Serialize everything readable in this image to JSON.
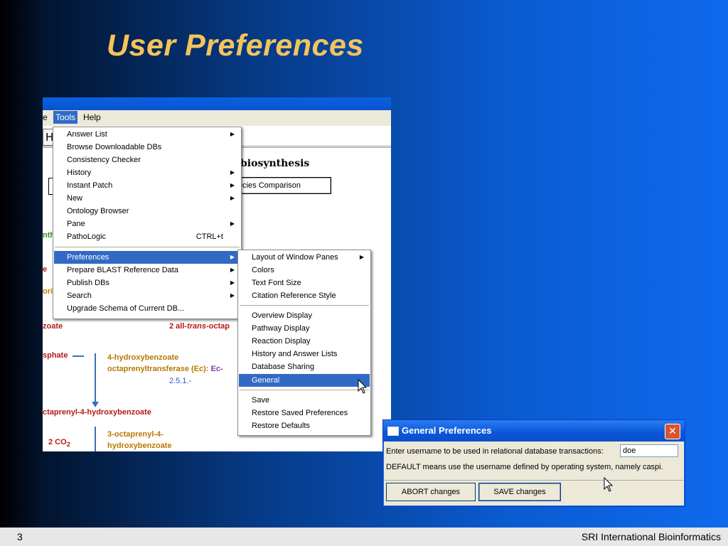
{
  "slide": {
    "title": "User Preferences",
    "page_number": "3",
    "footer_org": "SRI International Bioinformatics"
  },
  "app": {
    "menubar": {
      "partial_item": "e",
      "tools": "Tools",
      "help": "Help"
    },
    "toolbar_partial": "H",
    "pathway_title_partial": "biosynthesis",
    "compare_button_partial": "ecies Comparison",
    "pathway": {
      "frag_nth": "nth",
      "frag_e": "e",
      "frag_ori": "ori",
      "zoate": "zoate",
      "all_trans_prefix": "2 all-",
      "all_trans_italic": "trans",
      "all_trans_suffix": "-octap",
      "sphate": "sphate",
      "enzyme_line1": "4-hydroxybenzoate",
      "enzyme_line2": "octaprenyltransferase (Ec):",
      "enzyme_ec_prefix": "Ec-",
      "ec_number": "2.5.1.-",
      "product": "ctaprenyl-4-hydroxybenzoate",
      "co2_prefix": "2 CO",
      "co2_sub": "2",
      "product2_line1": "3-octaprenyl-4-",
      "product2_line2": "hydroxybenzoate"
    },
    "tools_menu": [
      {
        "label": "Answer List",
        "submenu": true
      },
      {
        "label": "Browse Downloadable DBs"
      },
      {
        "label": "Consistency Checker"
      },
      {
        "label": "History",
        "submenu": true
      },
      {
        "label": "Instant Patch",
        "submenu": true
      },
      {
        "label": "New",
        "submenu": true
      },
      {
        "label": "Ontology Browser"
      },
      {
        "label": "Pane",
        "submenu": true
      },
      {
        "label": "PathoLogic",
        "shortcut": "CTRL+t"
      },
      {
        "label": "Preferences",
        "submenu": true,
        "highlighted": true
      },
      {
        "label": "Prepare BLAST Reference Data",
        "submenu": true
      },
      {
        "label": "Publish DBs",
        "submenu": true
      },
      {
        "label": "Search",
        "submenu": true
      },
      {
        "label": "Upgrade Schema of Current DB..."
      }
    ],
    "preferences_menu": [
      {
        "label": "Layout of Window Panes",
        "submenu": true
      },
      {
        "label": "Colors"
      },
      {
        "label": "Text Font Size"
      },
      {
        "label": "Citation Reference Style"
      },
      {
        "label": "Overview Display"
      },
      {
        "label": "Pathway Display"
      },
      {
        "label": "Reaction Display"
      },
      {
        "label": "History and Answer Lists"
      },
      {
        "label": "Database Sharing"
      },
      {
        "label": "General",
        "highlighted": true
      },
      {
        "label": "Save"
      },
      {
        "label": "Restore Saved Preferences"
      },
      {
        "label": "Restore Defaults"
      }
    ]
  },
  "dialog": {
    "title": "General Preferences",
    "username_prompt": "Enter username to be used in relational database transactions:",
    "username_value": "doe",
    "default_note": "DEFAULT means use the username defined by operating system, namely caspi.",
    "abort_label": "ABORT changes",
    "save_label": "SAVE changes",
    "close_glyph": "✕"
  },
  "icons": {
    "submenu_arrow": "▶",
    "close": "close-icon",
    "window": "window-icon",
    "cursor": "mouse-pointer-icon"
  },
  "colors": {
    "title": "#f4c45a",
    "highlight": "#316ac5",
    "titlebar": "#0a56d8"
  }
}
